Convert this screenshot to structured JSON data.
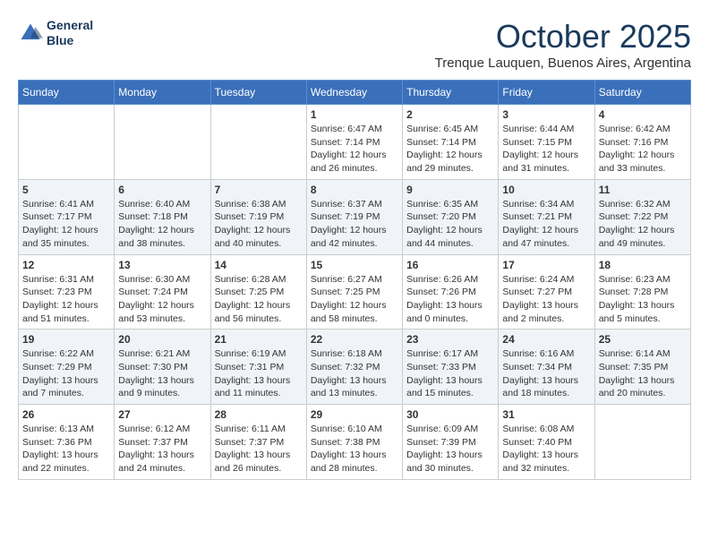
{
  "logo": {
    "line1": "General",
    "line2": "Blue"
  },
  "title": "October 2025",
  "subtitle": "Trenque Lauquen, Buenos Aires, Argentina",
  "weekdays": [
    "Sunday",
    "Monday",
    "Tuesday",
    "Wednesday",
    "Thursday",
    "Friday",
    "Saturday"
  ],
  "weeks": [
    [
      {
        "day": "",
        "info": ""
      },
      {
        "day": "",
        "info": ""
      },
      {
        "day": "",
        "info": ""
      },
      {
        "day": "1",
        "info": "Sunrise: 6:47 AM\nSunset: 7:14 PM\nDaylight: 12 hours\nand 26 minutes."
      },
      {
        "day": "2",
        "info": "Sunrise: 6:45 AM\nSunset: 7:14 PM\nDaylight: 12 hours\nand 29 minutes."
      },
      {
        "day": "3",
        "info": "Sunrise: 6:44 AM\nSunset: 7:15 PM\nDaylight: 12 hours\nand 31 minutes."
      },
      {
        "day": "4",
        "info": "Sunrise: 6:42 AM\nSunset: 7:16 PM\nDaylight: 12 hours\nand 33 minutes."
      }
    ],
    [
      {
        "day": "5",
        "info": "Sunrise: 6:41 AM\nSunset: 7:17 PM\nDaylight: 12 hours\nand 35 minutes."
      },
      {
        "day": "6",
        "info": "Sunrise: 6:40 AM\nSunset: 7:18 PM\nDaylight: 12 hours\nand 38 minutes."
      },
      {
        "day": "7",
        "info": "Sunrise: 6:38 AM\nSunset: 7:19 PM\nDaylight: 12 hours\nand 40 minutes."
      },
      {
        "day": "8",
        "info": "Sunrise: 6:37 AM\nSunset: 7:19 PM\nDaylight: 12 hours\nand 42 minutes."
      },
      {
        "day": "9",
        "info": "Sunrise: 6:35 AM\nSunset: 7:20 PM\nDaylight: 12 hours\nand 44 minutes."
      },
      {
        "day": "10",
        "info": "Sunrise: 6:34 AM\nSunset: 7:21 PM\nDaylight: 12 hours\nand 47 minutes."
      },
      {
        "day": "11",
        "info": "Sunrise: 6:32 AM\nSunset: 7:22 PM\nDaylight: 12 hours\nand 49 minutes."
      }
    ],
    [
      {
        "day": "12",
        "info": "Sunrise: 6:31 AM\nSunset: 7:23 PM\nDaylight: 12 hours\nand 51 minutes."
      },
      {
        "day": "13",
        "info": "Sunrise: 6:30 AM\nSunset: 7:24 PM\nDaylight: 12 hours\nand 53 minutes."
      },
      {
        "day": "14",
        "info": "Sunrise: 6:28 AM\nSunset: 7:25 PM\nDaylight: 12 hours\nand 56 minutes."
      },
      {
        "day": "15",
        "info": "Sunrise: 6:27 AM\nSunset: 7:25 PM\nDaylight: 12 hours\nand 58 minutes."
      },
      {
        "day": "16",
        "info": "Sunrise: 6:26 AM\nSunset: 7:26 PM\nDaylight: 13 hours\nand 0 minutes."
      },
      {
        "day": "17",
        "info": "Sunrise: 6:24 AM\nSunset: 7:27 PM\nDaylight: 13 hours\nand 2 minutes."
      },
      {
        "day": "18",
        "info": "Sunrise: 6:23 AM\nSunset: 7:28 PM\nDaylight: 13 hours\nand 5 minutes."
      }
    ],
    [
      {
        "day": "19",
        "info": "Sunrise: 6:22 AM\nSunset: 7:29 PM\nDaylight: 13 hours\nand 7 minutes."
      },
      {
        "day": "20",
        "info": "Sunrise: 6:21 AM\nSunset: 7:30 PM\nDaylight: 13 hours\nand 9 minutes."
      },
      {
        "day": "21",
        "info": "Sunrise: 6:19 AM\nSunset: 7:31 PM\nDaylight: 13 hours\nand 11 minutes."
      },
      {
        "day": "22",
        "info": "Sunrise: 6:18 AM\nSunset: 7:32 PM\nDaylight: 13 hours\nand 13 minutes."
      },
      {
        "day": "23",
        "info": "Sunrise: 6:17 AM\nSunset: 7:33 PM\nDaylight: 13 hours\nand 15 minutes."
      },
      {
        "day": "24",
        "info": "Sunrise: 6:16 AM\nSunset: 7:34 PM\nDaylight: 13 hours\nand 18 minutes."
      },
      {
        "day": "25",
        "info": "Sunrise: 6:14 AM\nSunset: 7:35 PM\nDaylight: 13 hours\nand 20 minutes."
      }
    ],
    [
      {
        "day": "26",
        "info": "Sunrise: 6:13 AM\nSunset: 7:36 PM\nDaylight: 13 hours\nand 22 minutes."
      },
      {
        "day": "27",
        "info": "Sunrise: 6:12 AM\nSunset: 7:37 PM\nDaylight: 13 hours\nand 24 minutes."
      },
      {
        "day": "28",
        "info": "Sunrise: 6:11 AM\nSunset: 7:37 PM\nDaylight: 13 hours\nand 26 minutes."
      },
      {
        "day": "29",
        "info": "Sunrise: 6:10 AM\nSunset: 7:38 PM\nDaylight: 13 hours\nand 28 minutes."
      },
      {
        "day": "30",
        "info": "Sunrise: 6:09 AM\nSunset: 7:39 PM\nDaylight: 13 hours\nand 30 minutes."
      },
      {
        "day": "31",
        "info": "Sunrise: 6:08 AM\nSunset: 7:40 PM\nDaylight: 13 hours\nand 32 minutes."
      },
      {
        "day": "",
        "info": ""
      }
    ]
  ]
}
